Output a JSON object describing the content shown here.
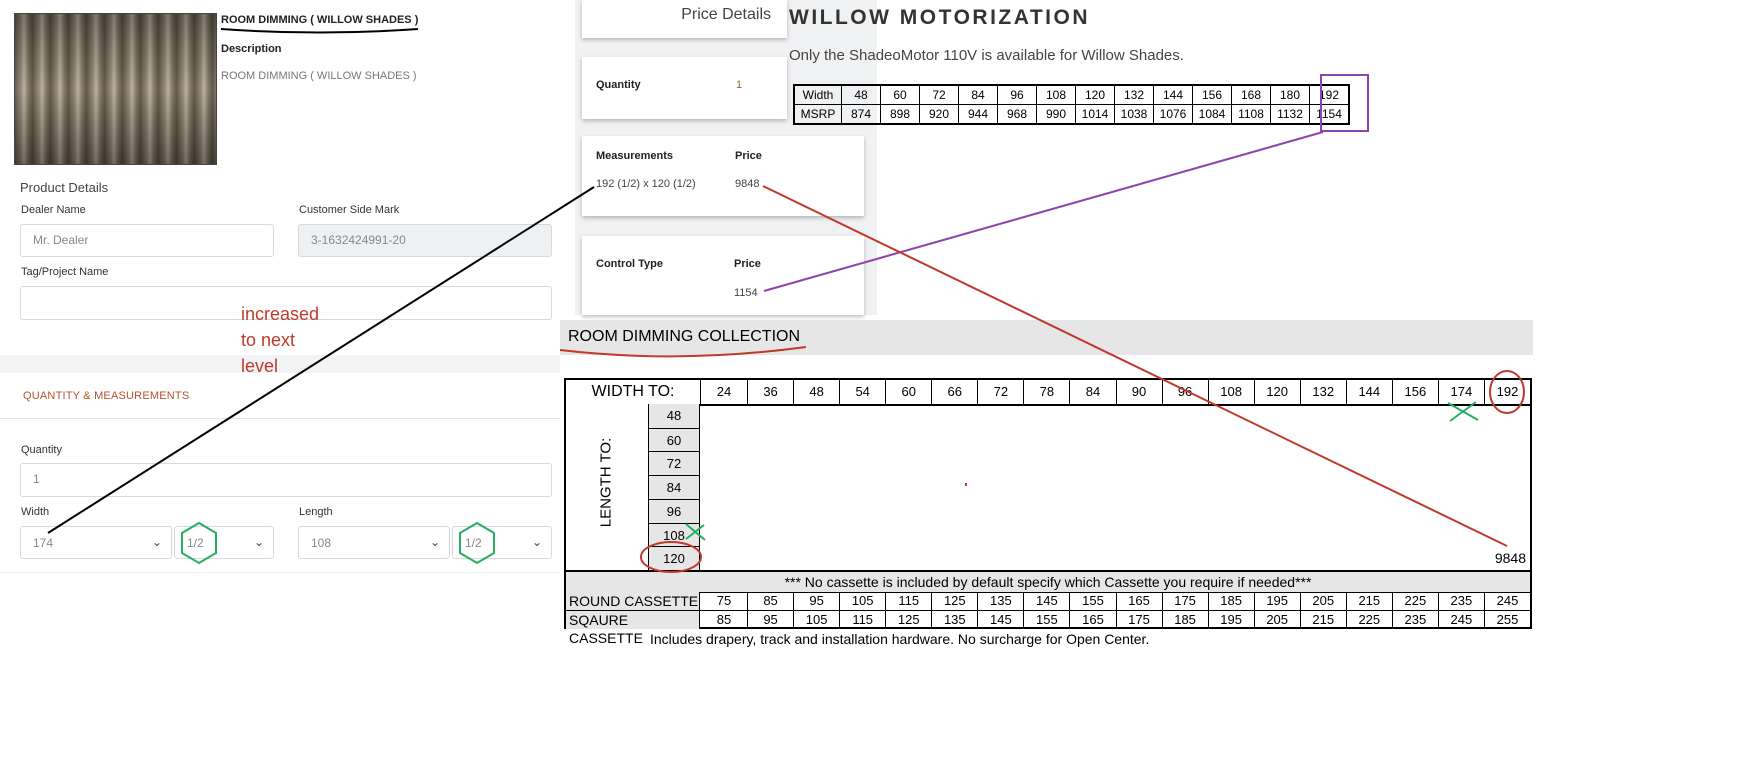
{
  "product": {
    "name": "ROOM DIMMING ( WILLOW SHADES )",
    "description_label": "Description",
    "description": "ROOM DIMMING ( WILLOW SHADES )"
  },
  "product_details": {
    "title": "Product Details",
    "dealer_name_label": "Dealer Name",
    "dealer_name_placeholder": "Mr. Dealer",
    "customer_side_mark_label": "Customer Side Mark",
    "customer_side_mark_value": "3-1632424991-20",
    "tag_label": "Tag/Project Name",
    "tag_value": ""
  },
  "quantity_measurements": {
    "title": "QUANTITY & MEASUREMENTS",
    "quantity_label": "Quantity",
    "quantity_value": "1",
    "width_label": "Width",
    "width_value": "174",
    "width_fraction": "1/2",
    "length_label": "Length",
    "length_value": "108",
    "length_fraction": "1/2"
  },
  "price_details": {
    "title": "Price Details",
    "quantity_label": "Quantity",
    "quantity_value": "1",
    "measurements_label": "Measurements",
    "measurements_price_label": "Price",
    "measurements_value": "192 (1/2) x 120 (1/2)",
    "measurements_price": "9848",
    "control_type_label": "Control Type",
    "control_price_label": "Price",
    "control_price": "1154"
  },
  "annotation": {
    "line1": "increased",
    "line2": "to next",
    "line3": "level"
  },
  "willow": {
    "title": "WILLOW MOTORIZATION",
    "subtitle": "Only the ShadeoMotor 110V is available for Willow Shades.",
    "row_labels": [
      "Width",
      "MSRP"
    ],
    "widths": [
      "48",
      "60",
      "72",
      "84",
      "96",
      "108",
      "120",
      "132",
      "144",
      "156",
      "168",
      "180",
      "192"
    ],
    "msrp": [
      "874",
      "898",
      "920",
      "944",
      "968",
      "990",
      "1014",
      "1038",
      "1076",
      "1084",
      "1108",
      "1132",
      "1154"
    ]
  },
  "collection": {
    "title": "ROOM DIMMING COLLECTION",
    "width_header": "WIDTH TO:",
    "length_header": "LENGTH TO:",
    "widths": [
      "24",
      "36",
      "48",
      "54",
      "60",
      "66",
      "72",
      "78",
      "84",
      "90",
      "96",
      "108",
      "120",
      "132",
      "144",
      "156",
      "174",
      "192"
    ],
    "lengths": [
      "48",
      "60",
      "72",
      "84",
      "96",
      "108",
      "120"
    ],
    "cell_value": "9848",
    "note": "*** No cassette is included by default specify which Cassette you require if needed***",
    "round_label": "ROUND CASSETTE",
    "round": [
      "75",
      "85",
      "95",
      "105",
      "115",
      "125",
      "135",
      "145",
      "155",
      "165",
      "175",
      "185",
      "195",
      "205",
      "215",
      "225",
      "235",
      "245"
    ],
    "square_label": "SQAURE CASSETTE",
    "square": [
      "85",
      "95",
      "105",
      "115",
      "125",
      "135",
      "145",
      "155",
      "165",
      "175",
      "185",
      "195",
      "205",
      "215",
      "225",
      "235",
      "245",
      "255"
    ],
    "footer": "Includes drapery, track and installation hardware. No surcharge for Open Center."
  },
  "colors": {
    "accent_orange": "#b3542b",
    "annotation_red": "#c0392b",
    "annotation_purple": "#8e44ad",
    "annotation_green": "#27ae60"
  }
}
